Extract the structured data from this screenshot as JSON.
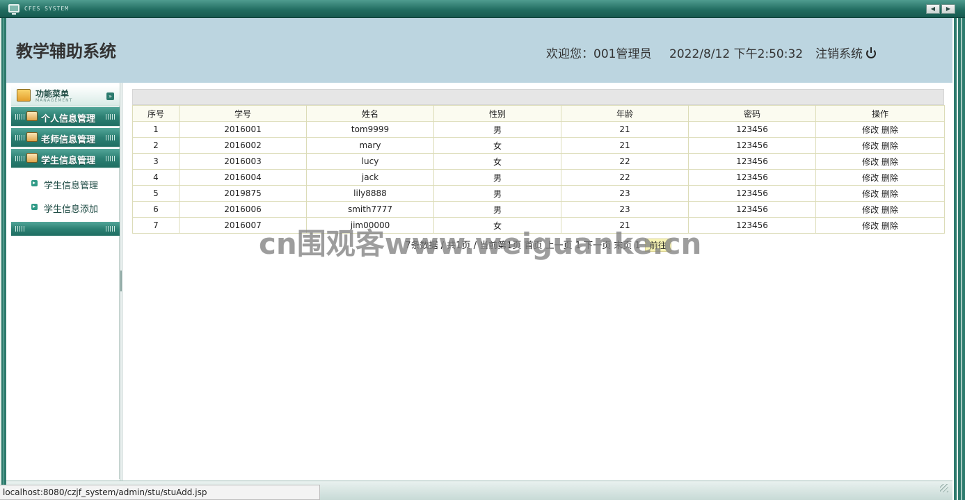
{
  "window": {
    "title": "CFES SYSTEM"
  },
  "header": {
    "system_title": "教学辅助系统",
    "welcome": "欢迎您：001管理员",
    "datetime": "2022/8/12 下午2:50:32",
    "logout_label": "注销系统"
  },
  "sidebar": {
    "menu_title": "功能菜单",
    "menu_subtitle": "MANAGEMENT",
    "groups": [
      {
        "label": "个人信息管理"
      },
      {
        "label": "老师信息管理"
      },
      {
        "label": "学生信息管理"
      }
    ],
    "sub_items": [
      {
        "label": "学生信息管理"
      },
      {
        "label": "学生信息添加"
      }
    ]
  },
  "table": {
    "headers": [
      "序号",
      "学号",
      "姓名",
      "性别",
      "年龄",
      "密码",
      "操作"
    ],
    "rows": [
      {
        "no": "1",
        "sid": "2016001",
        "name": "tom9999",
        "gender": "男",
        "age": "21",
        "password": "123456"
      },
      {
        "no": "2",
        "sid": "2016002",
        "name": "mary",
        "gender": "女",
        "age": "21",
        "password": "123456"
      },
      {
        "no": "3",
        "sid": "2016003",
        "name": "lucy",
        "gender": "女",
        "age": "22",
        "password": "123456"
      },
      {
        "no": "4",
        "sid": "2016004",
        "name": "jack",
        "gender": "男",
        "age": "22",
        "password": "123456"
      },
      {
        "no": "5",
        "sid": "2019875",
        "name": "lily8888",
        "gender": "男",
        "age": "23",
        "password": "123456"
      },
      {
        "no": "6",
        "sid": "2016006",
        "name": "smith7777",
        "gender": "男",
        "age": "23",
        "password": "123456"
      },
      {
        "no": "7",
        "sid": "2016007",
        "name": "jim00000",
        "gender": "女",
        "age": "21",
        "password": "123456"
      }
    ],
    "edit_label": "修改",
    "delete_label": "删除"
  },
  "pager": {
    "text": "7条数据 / 共1页 / 当前第1页 首页 上一页 1 下一页 末页 1",
    "go_label": "前往"
  },
  "watermark": "cn围观客www.weiguanke.cn",
  "statusbar": {
    "url": "localhost:8080/czjf_system/admin/stu/stuAdd.jsp"
  }
}
